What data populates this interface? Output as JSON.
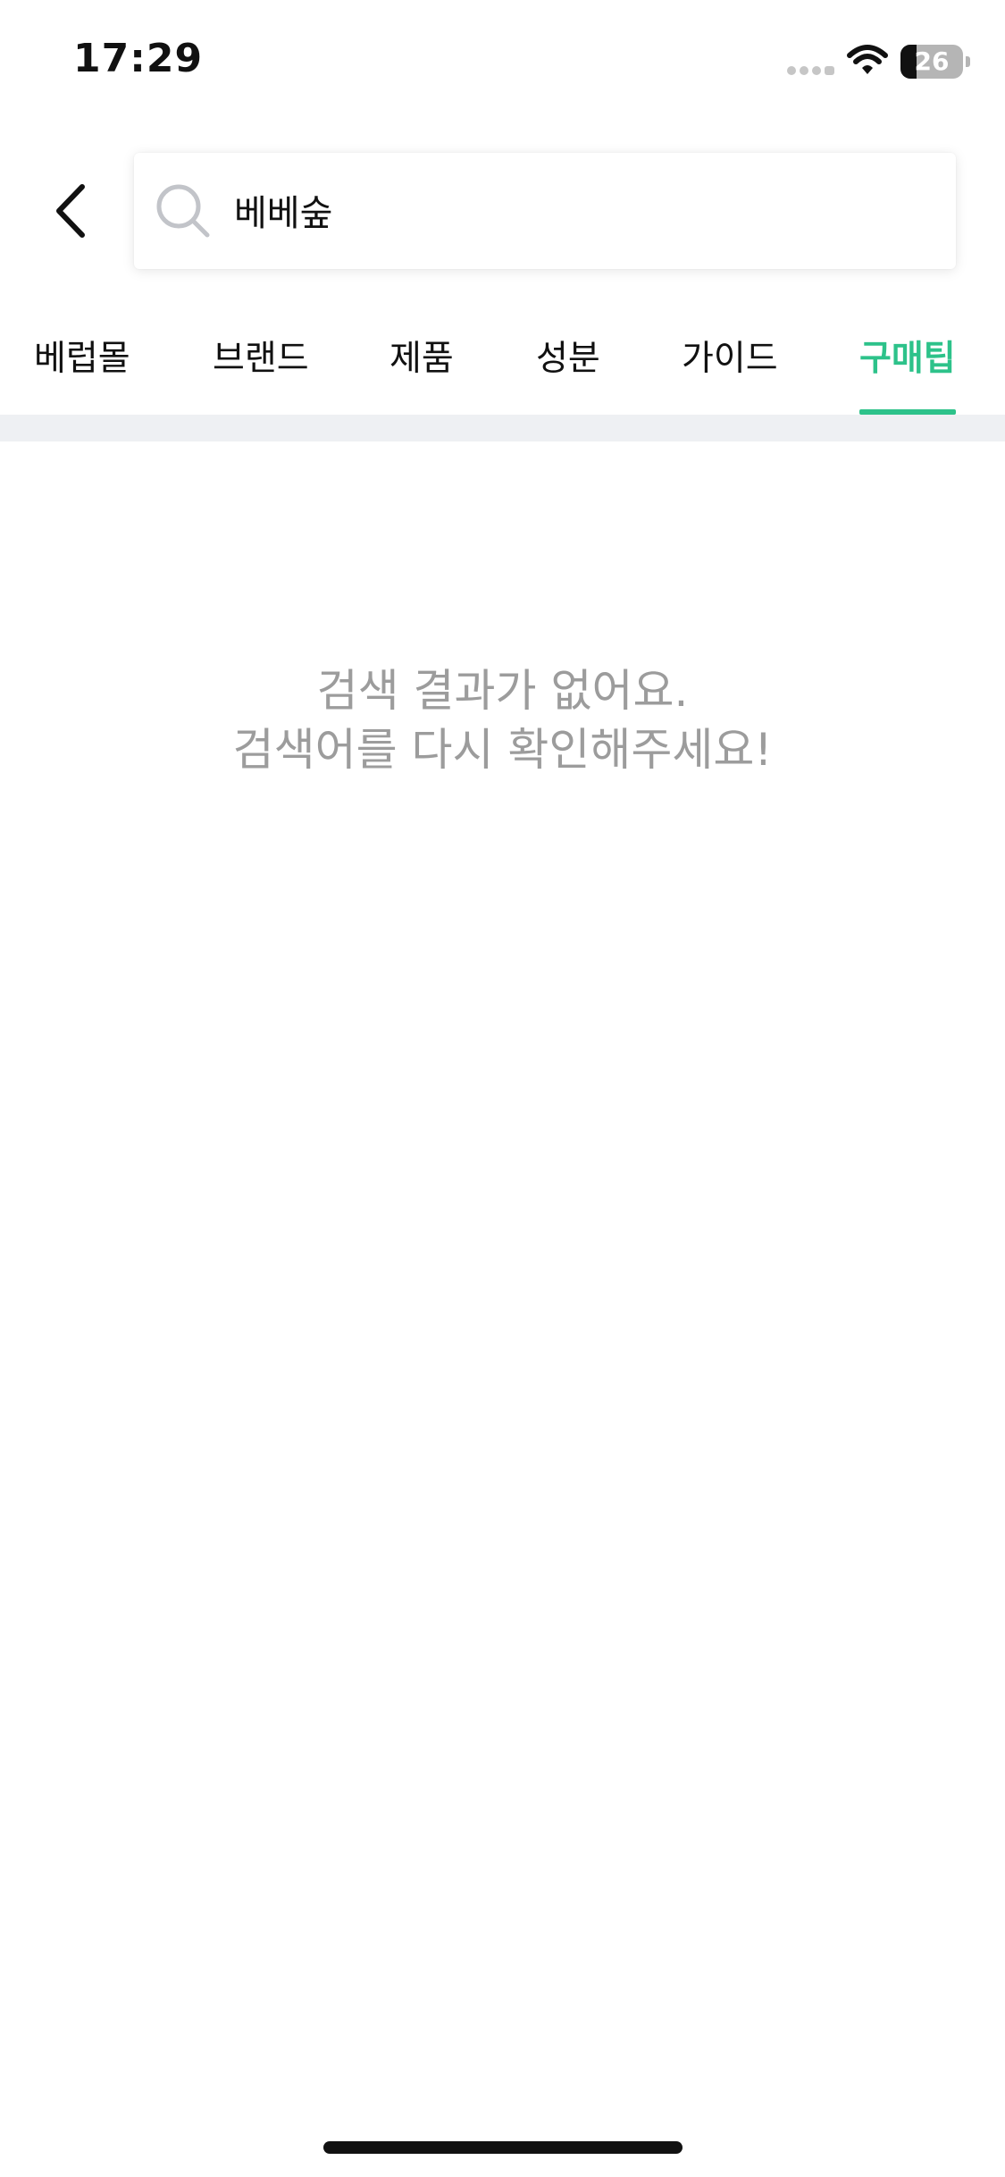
{
  "status_bar": {
    "time": "17:29",
    "battery_level": "26",
    "battery_percent": 26,
    "icons": [
      "signal-icon",
      "wifi-icon",
      "battery-icon"
    ]
  },
  "header": {
    "back_icon": "chevron-left-icon",
    "search_icon": "search-icon",
    "search_value": "베베숲"
  },
  "tabs": [
    {
      "label": "베럽몰",
      "active": false
    },
    {
      "label": "브랜드",
      "active": false
    },
    {
      "label": "제품",
      "active": false
    },
    {
      "label": "성분",
      "active": false
    },
    {
      "label": "가이드",
      "active": false
    },
    {
      "label": "구매팁",
      "active": true
    }
  ],
  "empty_state": {
    "line1": "검색 결과가 없어요.",
    "line2": "검색어를 다시 확인해주세요!"
  },
  "colors": {
    "accent": "#2dc28a",
    "muted_text": "#9c9c9c",
    "divider": "#eef0f3"
  }
}
